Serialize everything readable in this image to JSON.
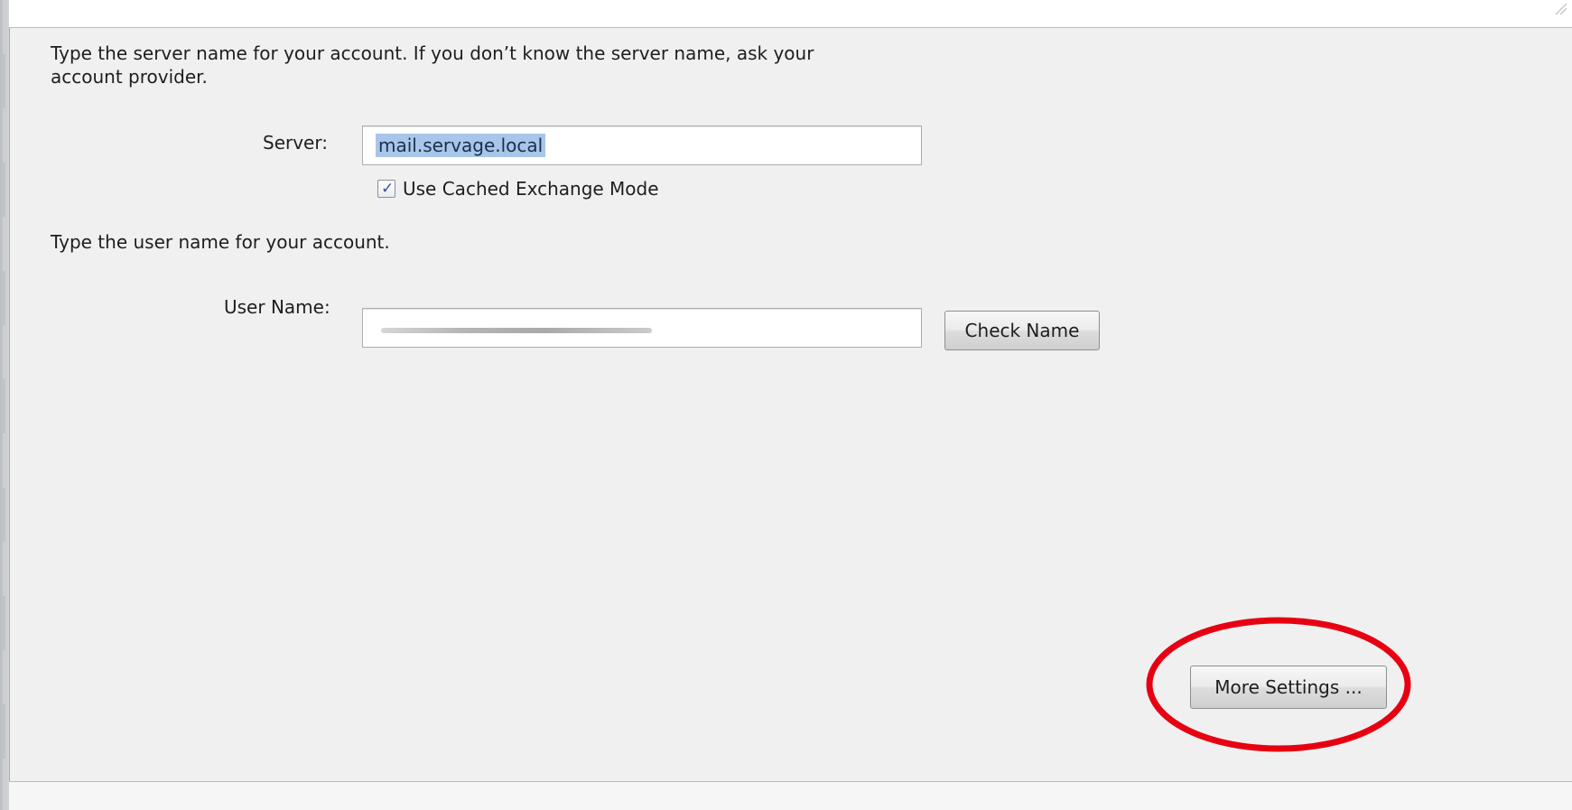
{
  "dialog": {
    "server_section": {
      "instructions_line1": "Type the server name for your account. If you don’t know the server name, ask your",
      "instructions_line2": "account provider.",
      "server_label": "Server:",
      "server_value": "mail.servage.local",
      "cached_mode_label": "Use Cached Exchange Mode",
      "cached_mode_checked": true,
      "check_glyph": "✓"
    },
    "user_section": {
      "instructions": "Type the user name for your account.",
      "username_label": "User Name:",
      "username_value_obscured": true,
      "check_name_label": "Check Name"
    },
    "footer": {
      "more_settings_label": "More Settings ..."
    },
    "annotation": {
      "highlight_color": "#e60012",
      "highlight_target": "more-settings-button"
    }
  }
}
